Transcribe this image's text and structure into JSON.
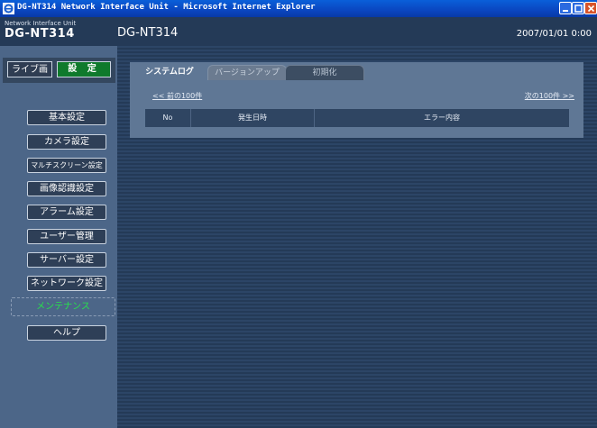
{
  "window": {
    "title": "DG-NT314 Network Interface Unit - Microsoft Internet Explorer"
  },
  "header": {
    "brand_small": "Network Interface Unit",
    "brand_big": "DG-NT314",
    "device_name": "DG-NT314",
    "datetime": "2007/01/01  0:00"
  },
  "mode": {
    "live_label": "ライブ画",
    "setup_label": "設 定"
  },
  "menu": {
    "items": [
      {
        "label": "基本設定"
      },
      {
        "label": "カメラ設定"
      },
      {
        "label": "マルチスクリーン設定"
      },
      {
        "label": "画像認識設定"
      },
      {
        "label": "アラーム設定"
      },
      {
        "label": "ユーザー管理"
      },
      {
        "label": "サーバー設定"
      },
      {
        "label": "ネットワーク設定"
      },
      {
        "label": "メンテナンス",
        "active": true
      },
      {
        "label": "ヘルプ"
      }
    ]
  },
  "tabs": [
    {
      "label": "システムログ",
      "active": true
    },
    {
      "label": "バージョンアップ"
    },
    {
      "label": "初期化"
    }
  ],
  "log": {
    "prev_link": "<< 前の100件",
    "next_link": "次の100件 >>",
    "columns": [
      "No",
      "発生日時",
      "エラー内容"
    ]
  },
  "colors": {
    "active_menu_text": "#27e24c",
    "setup_button": "#0f7a2c"
  }
}
